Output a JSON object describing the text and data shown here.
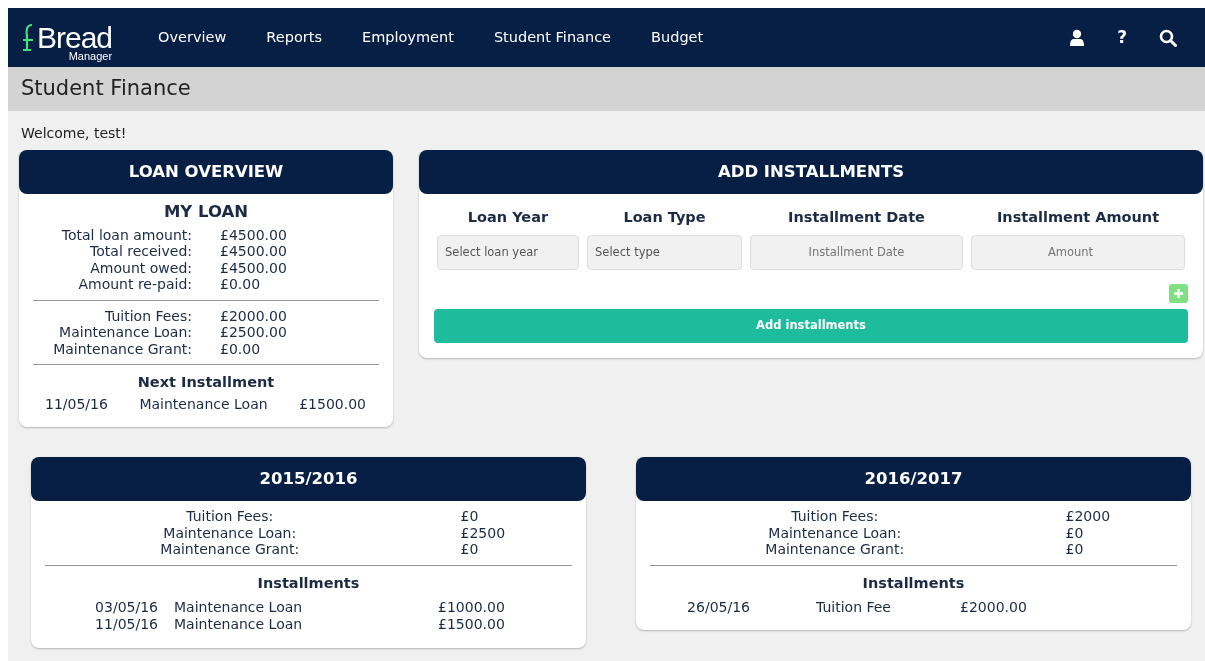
{
  "navbar": {
    "logo": {
      "title": "Bread",
      "subtitle": "Manager"
    },
    "links": [
      {
        "label": "Overview",
        "selected": false
      },
      {
        "label": "Reports",
        "selected": false
      },
      {
        "label": "Employment",
        "selected": false
      },
      {
        "label": "Student Finance",
        "selected": false
      },
      {
        "label": "Budget",
        "selected": false
      }
    ],
    "icons": [
      {
        "kind": "user"
      },
      {
        "kind": "help",
        "label": "?"
      },
      {
        "kind": "search"
      }
    ]
  },
  "page_title": "Student Finance",
  "welcome": "Welcome, test!",
  "loan_overview": {
    "header": "LOAN OVERVIEW",
    "title": "MY LOAN",
    "totals": [
      {
        "label": "Total loan amount:",
        "value": "£4500.00"
      },
      {
        "label": "Total received:",
        "value": "£4500.00"
      },
      {
        "label": "Amount owed:",
        "value": "£4500.00"
      },
      {
        "label": "Amount re-paid:",
        "value": "£0.00"
      }
    ],
    "breakdown": [
      {
        "label": "Tuition Fees:",
        "value": "£2000.00"
      },
      {
        "label": "Maintenance Loan:",
        "value": "£2500.00"
      },
      {
        "label": "Maintenance Grant:",
        "value": "£0.00"
      }
    ],
    "next_heading": "Next Installment",
    "next": {
      "date": "11/05/16",
      "type": "Maintenance Loan",
      "amount": "£1500.00"
    }
  },
  "add_installments": {
    "header": "ADD INSTALLMENTS",
    "fields": [
      {
        "label": "Loan Year",
        "kind": "select",
        "placeholder": "Select loan year"
      },
      {
        "label": "Loan Type",
        "kind": "select",
        "placeholder": "Select type"
      },
      {
        "label": "Installment Date",
        "kind": "date",
        "placeholder": "Installment Date"
      },
      {
        "label": "Installment Amount",
        "kind": "number",
        "placeholder": "Amount"
      }
    ],
    "add_button": "Add installments"
  },
  "years": [
    {
      "header": "2015/2016",
      "rows": [
        {
          "label": "Tuition Fees:",
          "value": "£0"
        },
        {
          "label": "Maintenance Loan:",
          "value": "£2500"
        },
        {
          "label": "Maintenance Grant:",
          "value": "£0"
        }
      ],
      "installments_heading": "Installments",
      "installments": [
        {
          "date": "03/05/16",
          "type": "Maintenance Loan",
          "amount": "£1000.00"
        },
        {
          "date": "11/05/16",
          "type": "Maintenance Loan",
          "amount": "£1500.00"
        }
      ]
    },
    {
      "header": "2016/2017",
      "rows": [
        {
          "label": "Tuition Fees:",
          "value": "£2000"
        },
        {
          "label": "Maintenance Loan:",
          "value": "£0"
        },
        {
          "label": "Maintenance Grant:",
          "value": "£0"
        }
      ],
      "installments_heading": "Installments",
      "installments": [
        {
          "date": "26/05/16",
          "type": "Tuition Fee",
          "amount": "£2000.00"
        }
      ]
    }
  ]
}
